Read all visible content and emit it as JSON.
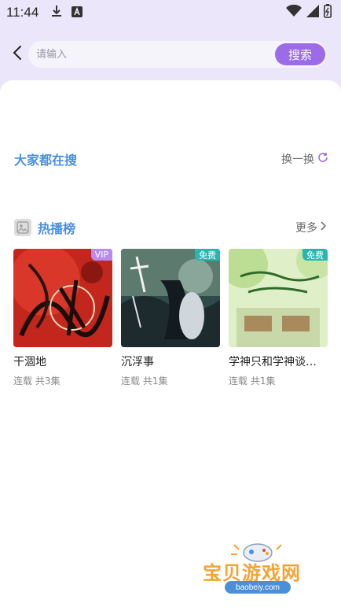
{
  "status_bar": {
    "time": "11:44",
    "icons": [
      "download-icon",
      "app-notification-icon",
      "wifi-icon",
      "cellular-signal-icon",
      "battery-icon"
    ]
  },
  "search": {
    "placeholder": "请输入",
    "button_label": "搜索",
    "back_icon": "chevron-left-icon"
  },
  "hot_search": {
    "title": "大家都在搜",
    "refresh_label": "换一换",
    "refresh_icon": "refresh-icon"
  },
  "ranking": {
    "title": "热播榜",
    "more_label": "更多",
    "more_icon": "chevron-right-icon",
    "items": [
      {
        "title": "干涸地",
        "meta": "连载 共3集",
        "badge": "VIP",
        "badge_color": "#b78cf0"
      },
      {
        "title": "沉浮事",
        "meta": "连载 共1集",
        "badge": "免费",
        "badge_color": "#27b7b0"
      },
      {
        "title": "学神只和学神谈…",
        "meta": "连载 共1集",
        "badge": "免费",
        "badge_color": "#27b7b0"
      }
    ]
  },
  "watermark": {
    "text": "宝贝游戏网",
    "url": "baobeiy.com"
  },
  "colors": {
    "accent": "#9b6be8",
    "section_title": "#4a8fe0",
    "header_bg": "#ece6fb"
  }
}
